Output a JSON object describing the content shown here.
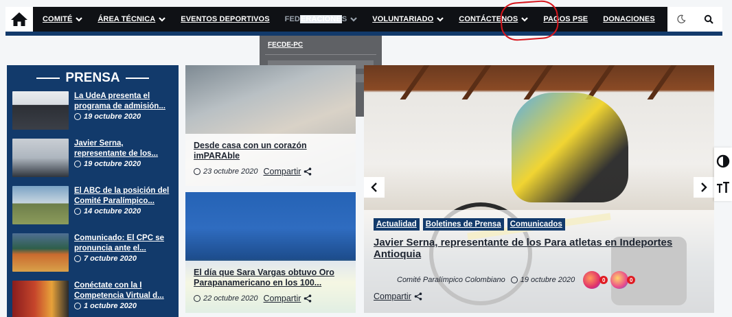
{
  "nav": {
    "items": [
      {
        "label": "COMITÉ",
        "has_dropdown": true
      },
      {
        "label": "ÁREA TÉCNICA",
        "has_dropdown": true
      },
      {
        "label": "EVENTOS DEPORTIVOS",
        "has_dropdown": false
      },
      {
        "label": "FEDERACIONES",
        "has_dropdown": true
      },
      {
        "label": "VOLUNTARIADO",
        "has_dropdown": true
      },
      {
        "label": "CONTÁCTENOS",
        "has_dropdown": true
      },
      {
        "label": "PAGOS PSE",
        "has_dropdown": false
      },
      {
        "label": "DONACIONES",
        "has_dropdown": false
      }
    ],
    "federaciones_prefix": "FED",
    "federaciones_highlight": "ERACIONE",
    "federaciones_suffix": "S",
    "dropdown": {
      "first_item": "FECDE-PC"
    }
  },
  "prensa": {
    "title": "PRENSA",
    "items": [
      {
        "title": "La UdeA presenta el programa de admisión...",
        "date": "19 octubre 2020"
      },
      {
        "title": "Javier Serna, representante de los...",
        "date": "19 octubre 2020"
      },
      {
        "title": "El ABC de la posición del Comité Paralímpico...",
        "date": "14 octubre 2020"
      },
      {
        "title": "Comunicado: El CPC se pronuncia ante el...",
        "date": "7 octubre 2020"
      },
      {
        "title": "Conéctate con la I Competencia Virtual d...",
        "date": "1 octubre 2020"
      }
    ]
  },
  "cards": [
    {
      "title": "Desde casa con un corazón imPARAble",
      "date": "23 octubre 2020",
      "share_label": "Compartir"
    },
    {
      "title": "El día que Sara Vargas obtuvo Oro Parapanamericano en los 100...",
      "date": "22 octubre 2020",
      "share_label": "Compartir"
    }
  ],
  "hero": {
    "tags": [
      "Actualidad",
      "Boletines de Prensa",
      "Comunicados"
    ],
    "title": "Javier Serna, representante de los Para atletas en Indeportes Antioquia",
    "author": "Comité Paralímpico Colombiano",
    "date": "19 octubre 2020",
    "share_label": "Compartir",
    "reaction_counts": [
      "0",
      "0"
    ]
  },
  "colors": {
    "navy": "#123a6b",
    "nav_bg": "#0f1115",
    "highlight_red": "#d7161d"
  }
}
